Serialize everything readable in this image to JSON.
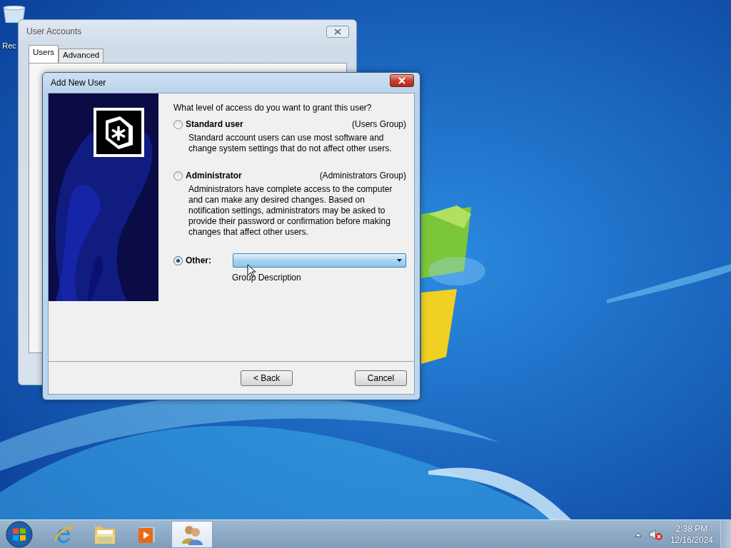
{
  "desktop": {
    "icons": [
      {
        "kind": "recycle-bin",
        "label": "Rec"
      }
    ]
  },
  "background_window": {
    "title": "User Accounts",
    "tabs": [
      {
        "label": "Users",
        "selected": true
      },
      {
        "label": "Advanced",
        "selected": false
      }
    ]
  },
  "dialog": {
    "title": "Add New User",
    "question": "What level of access do you want to grant this user?",
    "options": [
      {
        "kind": "described",
        "label": "Standard user",
        "group": "(Users Group)",
        "description": "Standard account users can use most software and change system settings that do not affect other users.",
        "selected": false
      },
      {
        "kind": "described",
        "label": "Administrator",
        "group": "(Administrators Group)",
        "description": "Administrators have complete access to the computer and can make any desired changes. Based on notification settings, administrators may be asked to provide their password or confirmation before making changes that affect other users.",
        "selected": false
      },
      {
        "kind": "dropdown",
        "label": "Other:",
        "selected": true
      }
    ],
    "group_description_label": "Group Description",
    "buttons": [
      {
        "label": "< Back"
      },
      {
        "label": "Cancel"
      }
    ]
  },
  "taskbar": {
    "apps": [
      {
        "kind": "start"
      },
      {
        "kind": "browser",
        "active": false
      },
      {
        "kind": "folder",
        "active": false
      },
      {
        "kind": "media",
        "active": false
      },
      {
        "kind": "users",
        "active": true
      }
    ],
    "tray": {
      "volume_muted": true
    },
    "clock": {
      "time": "2:38 PM",
      "date": "12/16/2024"
    }
  }
}
